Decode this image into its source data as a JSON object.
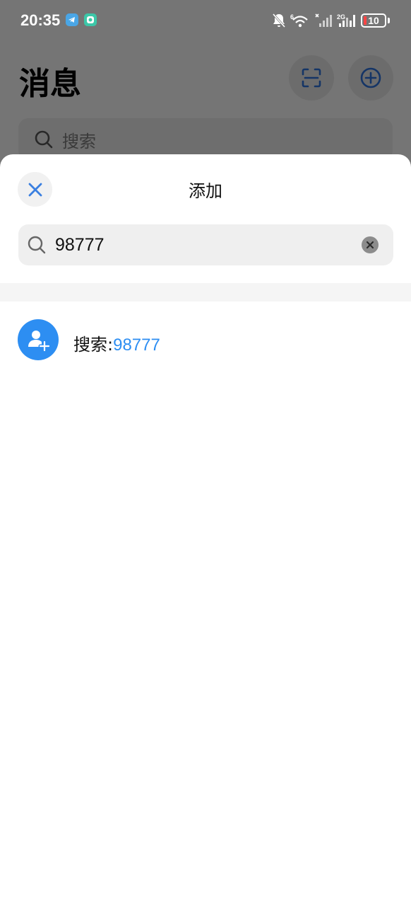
{
  "status_bar": {
    "time": "20:35",
    "battery_level": "10",
    "signal_2g_label": "2G",
    "signal_6_label": "6"
  },
  "background": {
    "title": "消息",
    "search_placeholder": "搜索"
  },
  "sheet": {
    "title": "添加",
    "search_value": "98777",
    "result": {
      "prefix": "搜索:",
      "keyword": "98777"
    }
  },
  "colors": {
    "accent": "#2d8ef2",
    "close_icon": "#3a7fe0",
    "battery_low": "#ff4444"
  },
  "icons": {
    "close": "close-icon",
    "search": "search-icon",
    "clear": "clear-icon",
    "add_user": "add-user-icon",
    "scan": "scan-icon",
    "add_circle": "add-circle-icon"
  }
}
